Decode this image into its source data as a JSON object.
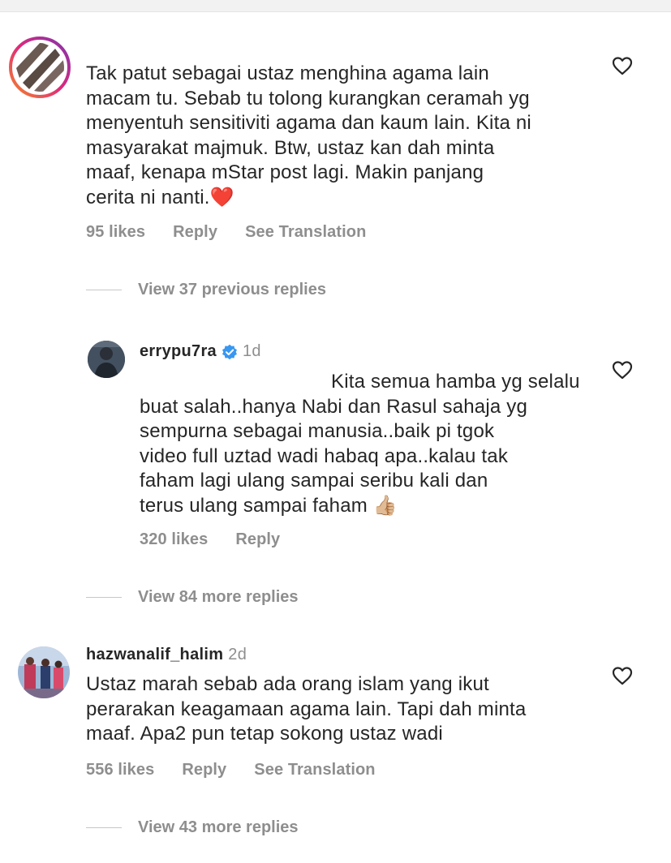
{
  "comments": [
    {
      "text_lines": [
        "Tak patut sebagai ustaz menghina agama lain",
        "macam tu. Sebab tu tolong kurangkan ceramah yg",
        "menyentuh sensitiviti agama dan kaum lain. Kita ni",
        "masyarakat majmuk. Btw, ustaz kan dah minta",
        "maaf, kenapa mStar post lagi. Makin panjang",
        "cerita ni nanti."
      ],
      "emoji": "❤️",
      "likes": "95 likes",
      "reply_label": "Reply",
      "translation_label": "See Translation",
      "replies_toggle": "View 37 previous replies"
    },
    {
      "username": "errypu7ra",
      "time": "1d",
      "text_lines": [
        "Kita semua hamba yg selalu",
        "buat salah..hanya Nabi dan Rasul sahaja yg",
        "sempurna sebagai manusia..baik pi tgok",
        "video full uztad wadi habaq apa..kalau tak",
        "faham lagi ulang sampai seribu kali dan",
        "terus ulang sampai faham"
      ],
      "emoji": "👍🏼",
      "likes": "320 likes",
      "reply_label": "Reply",
      "replies_toggle": "View 84 more replies"
    },
    {
      "username": "hazwanalif_halim",
      "time": "2d",
      "text_lines": [
        "Ustaz marah sebab ada orang islam yang ikut",
        "perarakan keagamaan agama lain. Tapi dah minta",
        "maaf. Apa2 pun tetap sokong ustaz wadi"
      ],
      "likes": "556 likes",
      "reply_label": "Reply",
      "translation_label": "See Translation",
      "replies_toggle": "View 43 more replies"
    }
  ],
  "colors": {
    "text": "#262626",
    "meta": "#8e8e8e",
    "verified": "#3897f0",
    "heart_emoji": "#e0245e",
    "story_ring": [
      "#f58529",
      "#dd2a7b",
      "#8134af"
    ]
  },
  "icons": {
    "like": "heart-outline-icon",
    "verified": "verified-badge-icon"
  }
}
